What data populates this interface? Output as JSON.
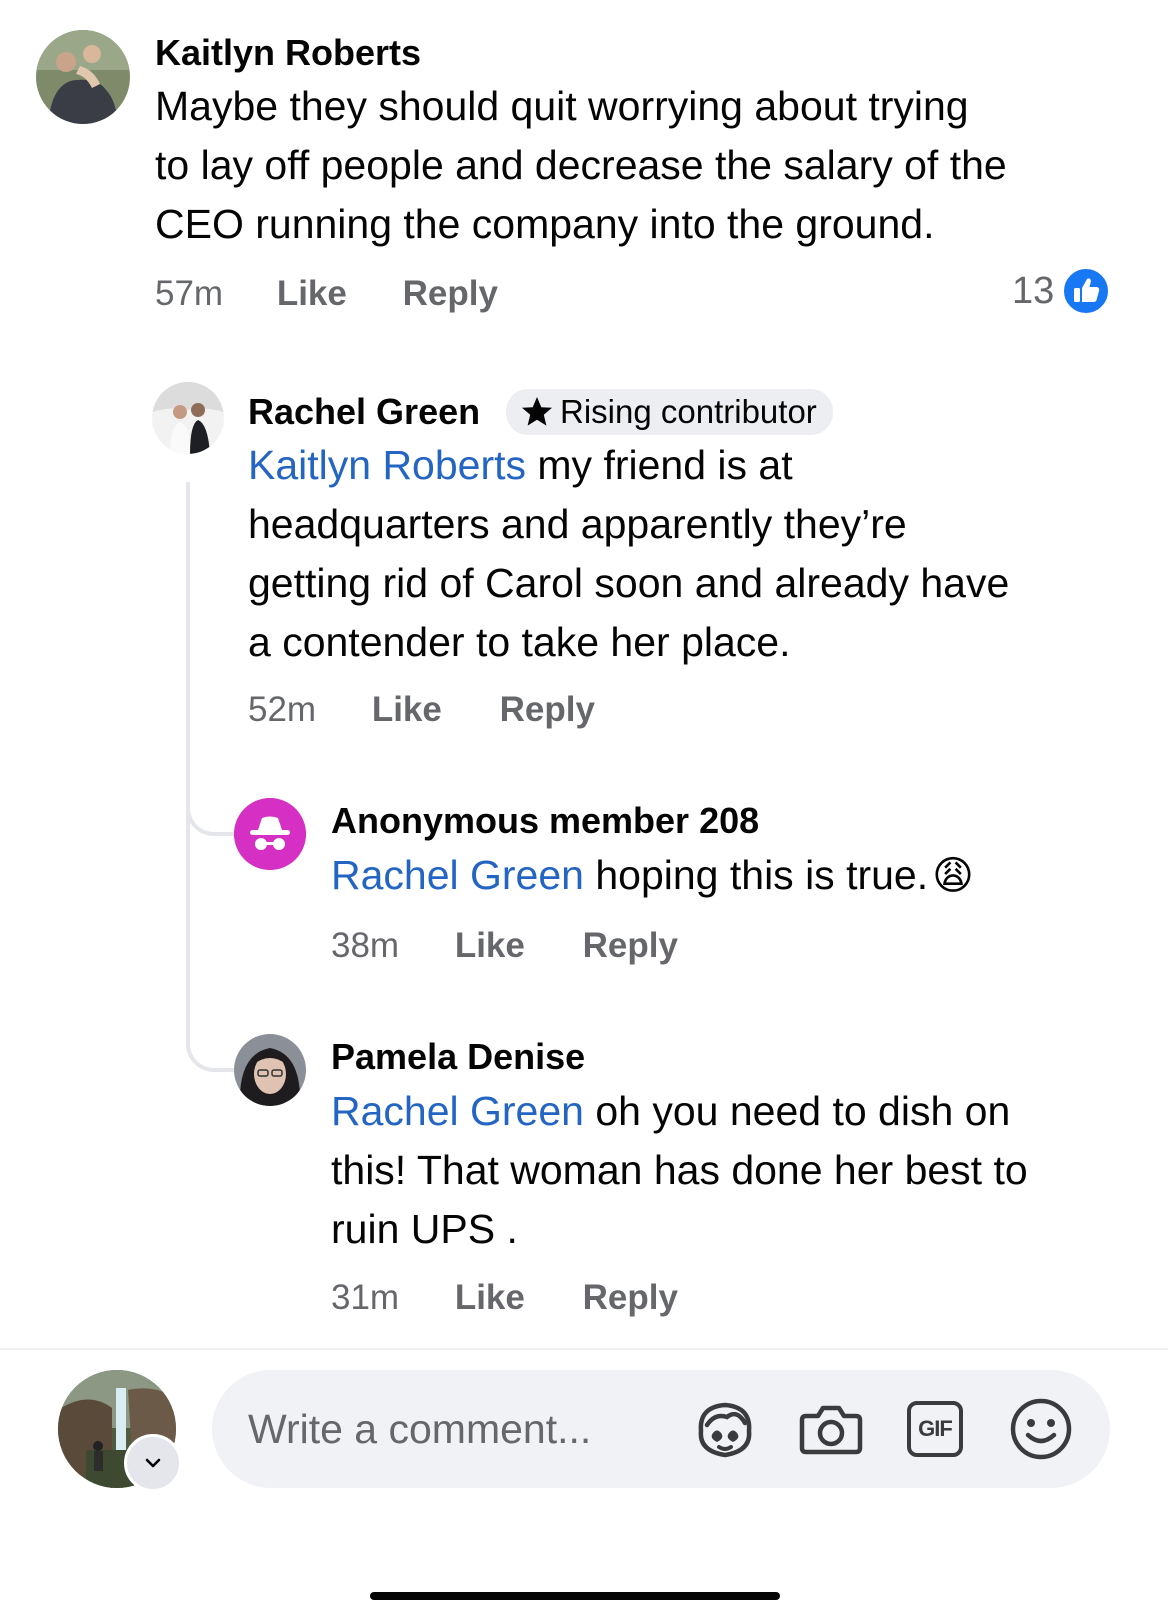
{
  "comments": [
    {
      "author": "Kaitlyn Roberts",
      "lines": [
        "Maybe they should quit worrying about trying",
        "to lay off people and decrease the salary of the",
        "CEO running the company into the ground."
      ],
      "time": "57m",
      "like": "Like",
      "reply": "Reply",
      "reaction_count": "13",
      "reaction_icon": "like-reaction-icon"
    }
  ],
  "replies": [
    {
      "author": "Rachel Green",
      "badge": "Rising contributor",
      "badge_icon": "star-icon",
      "mention": "Kaitlyn Roberts",
      "line1_rest": " my friend is at",
      "lines": [
        "headquarters and apparently they’re",
        "getting rid of Carol soon and already have",
        "a contender to take her place."
      ],
      "time": "52m",
      "like": "Like",
      "reply": "Reply"
    },
    {
      "author": "Anonymous member 208",
      "avatar_icon": "incognito-icon",
      "mention": "Rachel Green",
      "text": " hoping this is true.",
      "emoji": "😩",
      "time": "38m",
      "like": "Like",
      "reply": "Reply"
    },
    {
      "author": "Pamela Denise",
      "mention": "Rachel Green",
      "line1_rest": " oh you need to dish on",
      "lines": [
        "this! That woman has done her best to",
        "ruin UPS ."
      ],
      "time": "31m",
      "like": "Like",
      "reply": "Reply"
    }
  ],
  "composer": {
    "placeholder": "Write a comment...",
    "icons": [
      "avatar-sticker-icon",
      "camera-icon",
      "gif-icon",
      "emoji-icon"
    ],
    "gif_label": "GIF"
  },
  "colors": {
    "mention": "#2465c4",
    "meta": "#65676b",
    "like_blue": "#1877f2",
    "anon_magenta": "#d62fc4"
  }
}
